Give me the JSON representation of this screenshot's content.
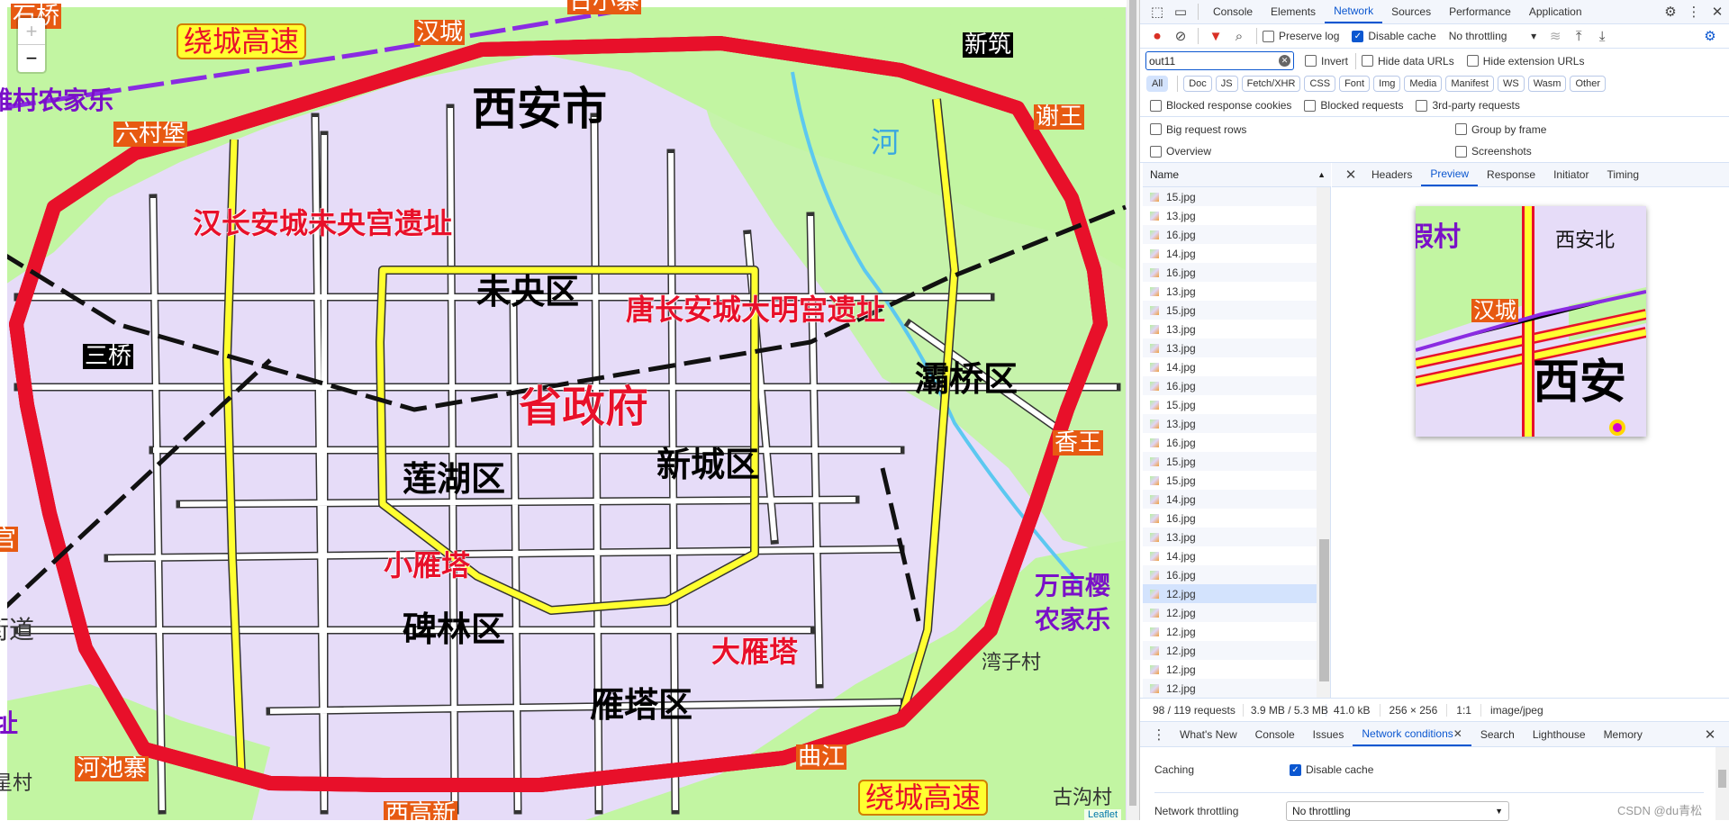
{
  "map": {
    "districts": [
      "西安市",
      "未央区",
      "灞桥区",
      "莲湖区",
      "新城区",
      "碑林区",
      "雁塔区"
    ],
    "landmarks": [
      "省政府",
      "汉长安城未央宫遗址",
      "唐长安城大明宫遗址",
      "小雁塔",
      "大雁塔"
    ],
    "callouts": [
      "绕城高速",
      "绕城高速"
    ],
    "interchanges": [
      "汉城",
      "六村堡",
      "谢王",
      "河池寨",
      "曲江",
      "香王",
      "宫",
      "西高新",
      "石桥",
      "日小寨"
    ],
    "stations": [
      "新筑",
      "三桥"
    ],
    "resorts": [
      "雒村农家乐",
      "万亩樱",
      "农家乐",
      "址"
    ],
    "villages": [
      "街道",
      "湾子村",
      "古沟村",
      "星村"
    ],
    "river": "河",
    "zoom_in": "+",
    "zoom_out": "−",
    "attribution": "Leaflet",
    "colors": {
      "urban": "#e6dcf8",
      "green": "#c2f5a2",
      "expressway": "#e8102a",
      "yellow_road": "#ffff30"
    }
  },
  "devtools": {
    "tabs": [
      "Console",
      "Elements",
      "Network",
      "Sources",
      "Performance",
      "Application"
    ],
    "active_tab": "Network",
    "toolbar": {
      "preserve_log": "Preserve log",
      "disable_cache": "Disable cache",
      "throttling": "No throttling"
    },
    "filter": {
      "value": "out11",
      "invert": "Invert",
      "hide_data": "Hide data URLs",
      "hide_ext": "Hide extension URLs"
    },
    "types": [
      "All",
      "Doc",
      "JS",
      "Fetch/XHR",
      "CSS",
      "Font",
      "Img",
      "Media",
      "Manifest",
      "WS",
      "Wasm",
      "Other"
    ],
    "blocked": [
      "Blocked response cookies",
      "Blocked requests",
      "3rd-party requests"
    ],
    "options": [
      "Big request rows",
      "Group by frame",
      "Overview",
      "Screenshots"
    ],
    "name_header": "Name",
    "files": [
      "15.jpg",
      "13.jpg",
      "16.jpg",
      "14.jpg",
      "16.jpg",
      "13.jpg",
      "15.jpg",
      "13.jpg",
      "13.jpg",
      "14.jpg",
      "16.jpg",
      "15.jpg",
      "13.jpg",
      "16.jpg",
      "15.jpg",
      "15.jpg",
      "14.jpg",
      "16.jpg",
      "13.jpg",
      "14.jpg",
      "16.jpg",
      "12.jpg",
      "12.jpg",
      "12.jpg",
      "12.jpg",
      "12.jpg",
      "12.jpg"
    ],
    "selected_index": 21,
    "detail_tabs": [
      "Headers",
      "Preview",
      "Response",
      "Initiator",
      "Timing"
    ],
    "active_detail": "Preview",
    "preview": {
      "labels": [
        "假村",
        "西安北",
        "汉城",
        "西安"
      ]
    },
    "status": {
      "requests": "98 / 119 requests",
      "transferred": "3.9 MB / 5.3 MB",
      "size": "41.0 kB",
      "dims": "256 × 256",
      "ratio": "1:1",
      "mime": "image/jpeg"
    },
    "drawer_tabs": [
      "What's New",
      "Console",
      "Issues",
      "Network conditions",
      "Search",
      "Lighthouse",
      "Memory"
    ],
    "active_drawer": "Network conditions",
    "caching_label": "Caching",
    "caching_value": "Disable cache",
    "throttling_label": "Network throttling",
    "throttling_value": "No throttling",
    "watermark": "CSDN @du青松"
  }
}
